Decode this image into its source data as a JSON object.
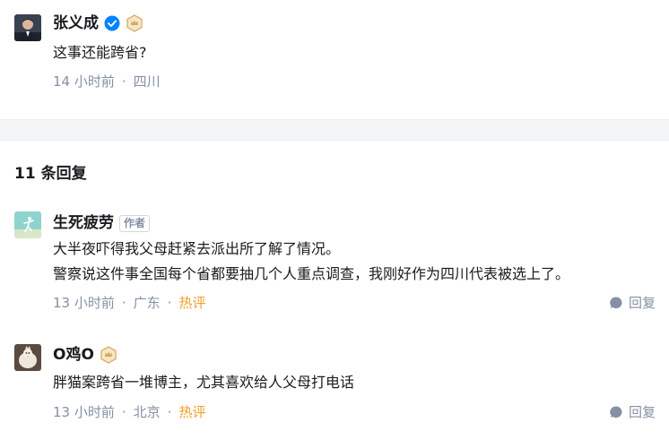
{
  "comment": {
    "author": "张义成",
    "verified_icon": "verified-check-icon",
    "level_icon": "crown-badge-icon",
    "text": "这事还能跨省?",
    "time": "14 小时前",
    "location": "四川"
  },
  "replies_header": "11 条回复",
  "replies": [
    {
      "author": "生死疲劳",
      "tag": "作者",
      "lines": [
        "大半夜吓得我父母赶紧去派出所了解了情况。",
        "警察说这件事全国每个省都要抽几个人重点调查，我刚好作为四川代表被选上了。"
      ],
      "time": "13 小时前",
      "location": "广东",
      "hot": "热评",
      "reply_label": "回复"
    },
    {
      "author": "O鸡O",
      "level_icon": "crown-badge-icon",
      "lines": [
        "胖猫案跨省一堆博主，尤其喜欢给人父母打电话"
      ],
      "time": "13 小时前",
      "location": "北京",
      "hot": "热评",
      "reply_label": "回复"
    }
  ],
  "colors": {
    "meta": "#8590a6",
    "hot": "#f0a02b",
    "verified": "#0084ff",
    "badge": "#d8a65a",
    "divider": "#f4f5f7"
  }
}
